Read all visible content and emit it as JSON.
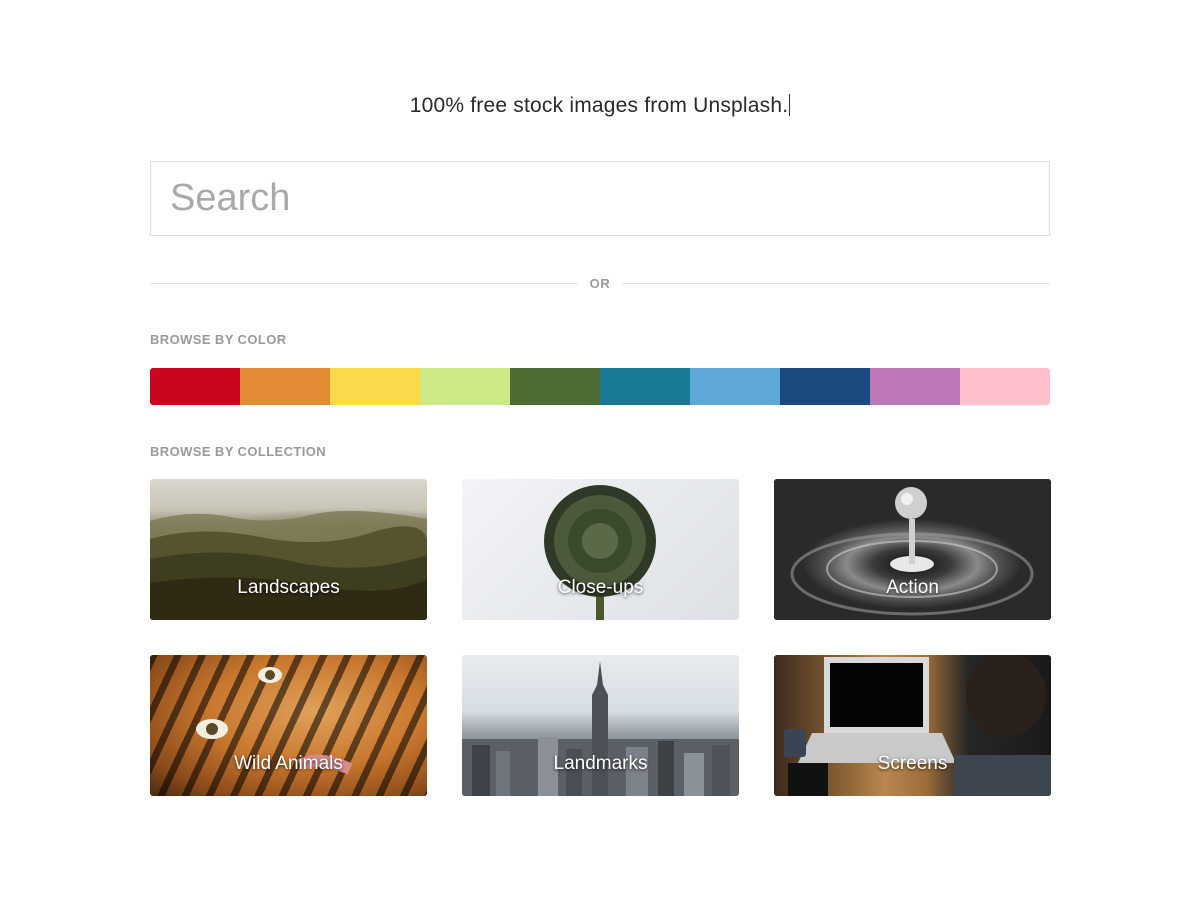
{
  "header": {
    "tagline": "100% free stock images from Unsplash."
  },
  "search": {
    "placeholder": "Search",
    "value": ""
  },
  "divider": {
    "or_label": "OR"
  },
  "browse_color": {
    "label": "BROWSE BY COLOR",
    "swatches": [
      {
        "name": "red",
        "hex": "#c9061c"
      },
      {
        "name": "orange",
        "hex": "#e18b34"
      },
      {
        "name": "yellow",
        "hex": "#f9da4a"
      },
      {
        "name": "light-green",
        "hex": "#cde886"
      },
      {
        "name": "dark-green",
        "hex": "#4f6b34"
      },
      {
        "name": "teal",
        "hex": "#187a94"
      },
      {
        "name": "light-blue",
        "hex": "#5ea8d8"
      },
      {
        "name": "navy",
        "hex": "#1a4a80"
      },
      {
        "name": "purple",
        "hex": "#bd78ba"
      },
      {
        "name": "pink",
        "hex": "#ffc0cc"
      }
    ]
  },
  "browse_collection": {
    "label": "BROWSE BY COLLECTION",
    "collections": [
      {
        "label": "Landscapes"
      },
      {
        "label": "Close-ups"
      },
      {
        "label": "Action"
      },
      {
        "label": "Wild Animals"
      },
      {
        "label": "Landmarks"
      },
      {
        "label": "Screens"
      }
    ]
  }
}
